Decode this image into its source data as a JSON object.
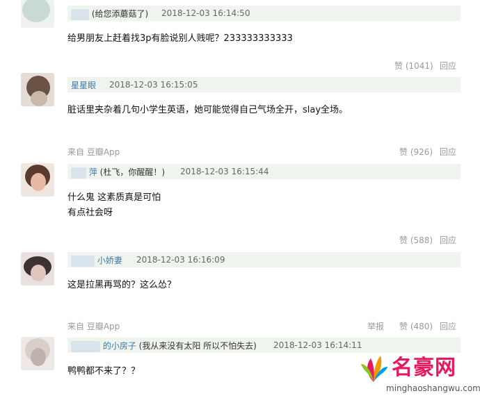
{
  "comments": [
    {
      "name": "",
      "note": "(给您添蘑菇了)",
      "time": "2018-12-03 16:14:50",
      "lines": [
        "给男朋友上赶着找3p有脸说别人贱呢？233333333333"
      ],
      "source": "",
      "report": "",
      "likes": "赞 (1041)",
      "reply": "回应"
    },
    {
      "name": "星星眼",
      "note": "",
      "time": "2018-12-03 16:15:05",
      "lines": [
        "脏话里夹杂着几句小学生英语，她可能觉得自己气场全开，slay全场。"
      ],
      "source": "来自 豆瓣App",
      "report": "",
      "likes": "赞 (926)",
      "reply": "回应"
    },
    {
      "name": "萍",
      "note": "(杜飞，你醒醒！)",
      "time": "2018-12-03 16:15:44",
      "lines": [
        "什么鬼 这素质真是可怕",
        "有点社会呀"
      ],
      "source": "",
      "report": "",
      "likes": "赞 (588)",
      "reply": "回应"
    },
    {
      "name": "小娇妻",
      "note": "",
      "time": "2018-12-03 16:16:09",
      "lines": [
        "这是拉黑再骂的？这么怂？"
      ],
      "source": "来自 豆瓣App",
      "report": "举报",
      "likes": "赞 (480)",
      "reply": "回应"
    },
    {
      "name": "的小房子",
      "note": "(我从来没有太阳 所以不怕失去)",
      "time": "2018-12-03 16:14:11",
      "lines": [
        "鸭鸭都不来了？？"
      ],
      "source": "",
      "report": "",
      "likes": "",
      "reply": ""
    }
  ],
  "watermark": {
    "title": "名豪网",
    "url": "minghaoshangwu.com"
  }
}
